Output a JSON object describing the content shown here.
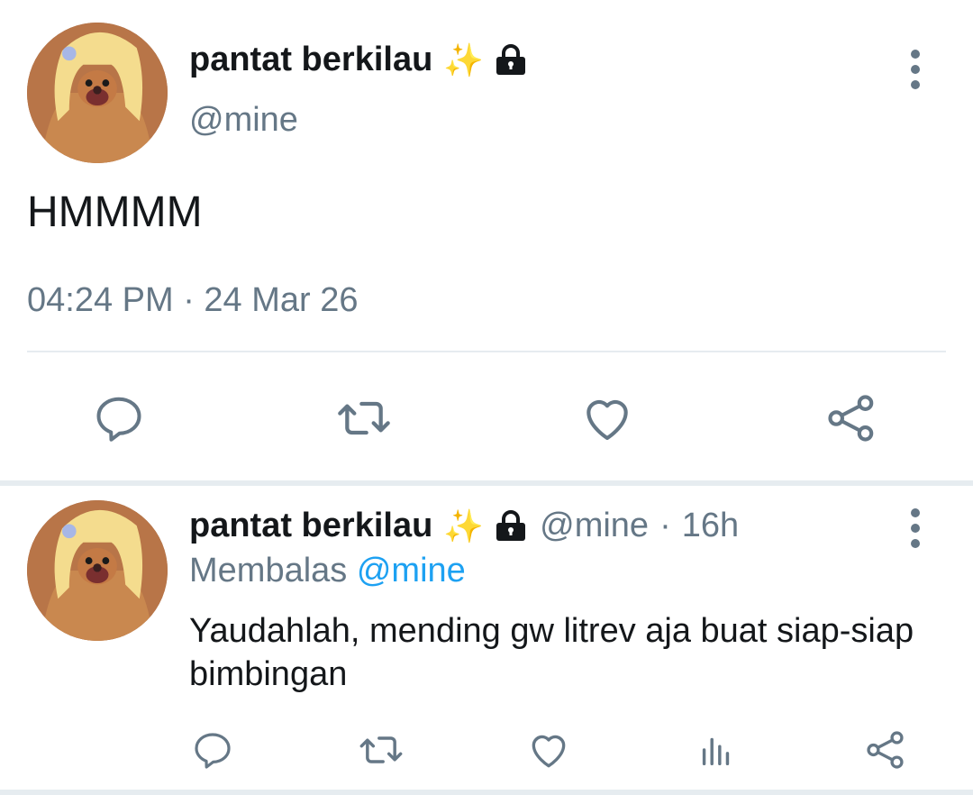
{
  "main_tweet": {
    "display_name": "pantat berkilau",
    "sparkle": "✨",
    "handle": "@mine",
    "text": "HMMMM",
    "timestamp": "04:24 PM · 24 Mar 26"
  },
  "reply_tweet": {
    "display_name": "pantat berkilau",
    "sparkle": "✨",
    "handle": "@mine",
    "separator": "·",
    "time": "16h",
    "replying_label": "Membalas",
    "replying_to": "@mine",
    "text": "Yaudahlah, mending gw litrev aja buat siap-siap bimbingan"
  },
  "icons": {
    "reply": "comment-icon",
    "retweet": "retweet-icon",
    "like": "heart-icon",
    "analytics": "analytics-icon",
    "share": "share-icon",
    "more": "more-vertical-icon",
    "lock": "lock-icon"
  },
  "colors": {
    "text": "#14171a",
    "muted": "#657786",
    "link": "#1da1f2",
    "divider": "#e6ecf0"
  }
}
